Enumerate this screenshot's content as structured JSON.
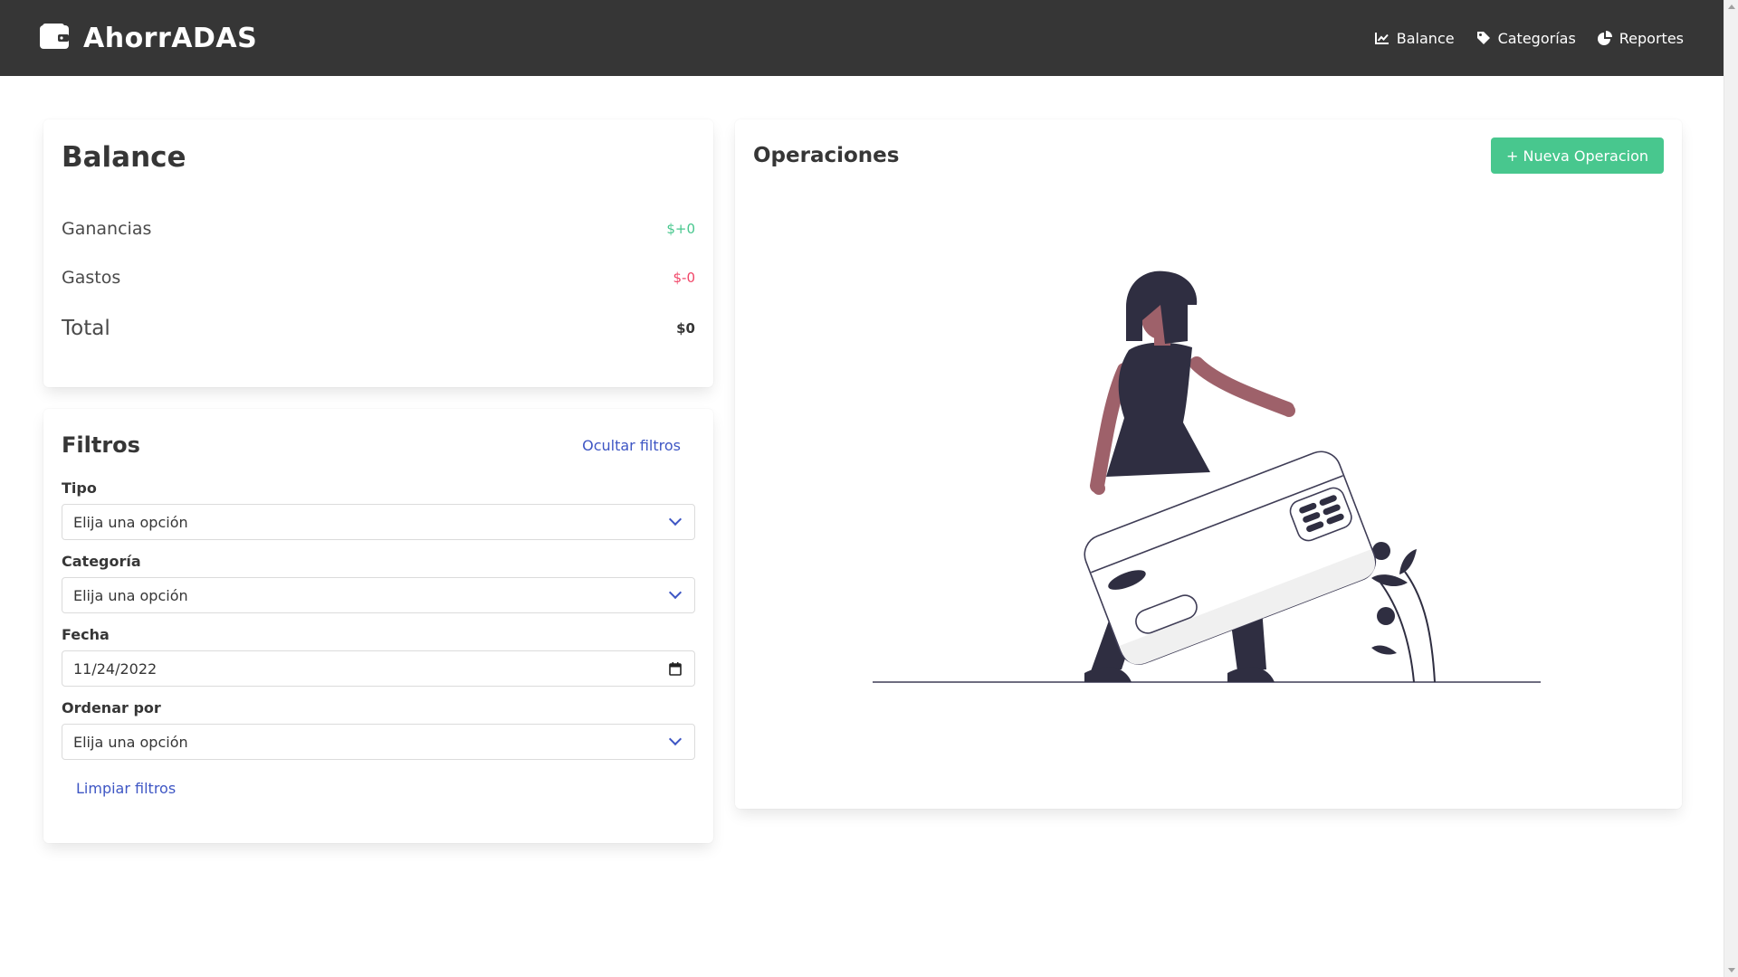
{
  "nav": {
    "brand": "AhorrADAS",
    "links": [
      {
        "label": "Balance",
        "icon": "chart-line-icon"
      },
      {
        "label": "Categorías",
        "icon": "tag-icon"
      },
      {
        "label": "Reportes",
        "icon": "pie-chart-icon"
      }
    ]
  },
  "balance": {
    "title": "Balance",
    "ganancias_label": "Ganancias",
    "ganancias_value": "$+0",
    "gastos_label": "Gastos",
    "gastos_value": "$-0",
    "total_label": "Total",
    "total_value": "$0"
  },
  "filters": {
    "title": "Filtros",
    "toggle_link": "Ocultar filtros",
    "tipo_label": "Tipo",
    "tipo_value": "Elija una opción",
    "categoria_label": "Categoría",
    "categoria_value": "Elija una opción",
    "fecha_label": "Fecha",
    "fecha_value": "11/24/2022",
    "orden_label": "Ordenar por",
    "orden_value": "Elija una opción",
    "clear_link": "Limpiar filtros"
  },
  "operations": {
    "title": "Operaciones",
    "new_button": "+ Nueva Operacion"
  },
  "colors": {
    "navbar": "#363636",
    "success": "#48c78e",
    "danger": "#f14668",
    "link": "#3e56c4",
    "skin": "#9e616a",
    "dark": "#2f2e41"
  }
}
